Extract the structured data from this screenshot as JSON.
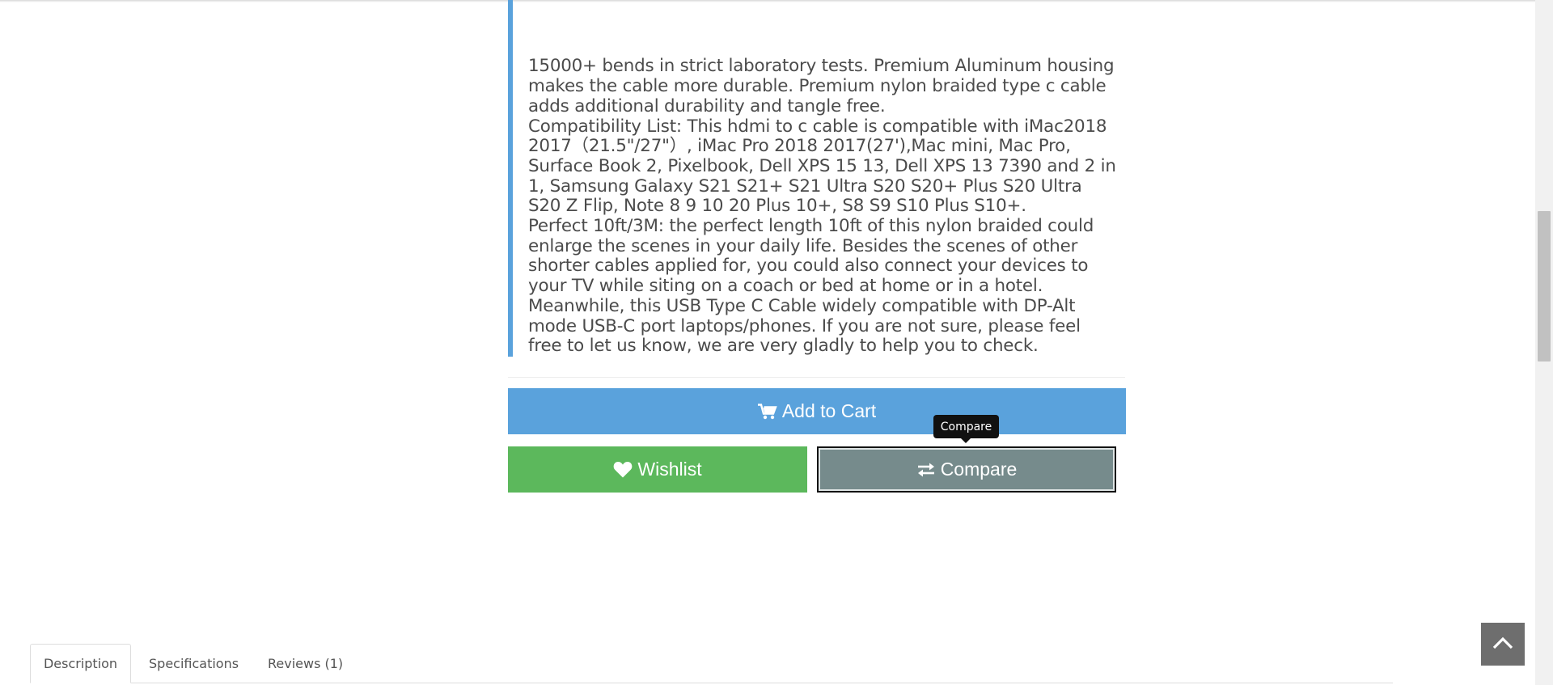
{
  "description": {
    "paragraphs": [
      "15000+ bends in strict laboratory tests. Premium Aluminum housing makes the cable more durable. Premium nylon braided type c cable adds additional durability and tangle free.",
      "Compatibility List: This hdmi to c cable is compatible with iMac2018 2017（21.5\"/27\"）, iMac Pro 2018 2017(27'),Mac mini, Mac Pro, Surface Book 2, Pixelbook, Dell XPS 15 13, Dell XPS 13 7390 and 2 in 1, Samsung Galaxy S21 S21+ S21 Ultra S20 S20+ Plus S20 Ultra S20 Z Flip, Note 8 9 10 20 Plus 10+, S8 S9 S10 Plus S10+.",
      "Perfect 10ft/3M: the perfect length 10ft of this nylon braided could enlarge the scenes in your daily life. Besides the scenes of other shorter cables applied for, you could also connect your devices to your TV while siting on a coach or bed at home or in a hotel. Meanwhile, this USB Type C Cable widely compatible with DP-Alt mode USB-C port laptops/phones. If you are not sure, please feel free to let us know, we are very gladly to help you to check."
    ]
  },
  "actions": {
    "add_to_cart": "Add to Cart",
    "wishlist": "Wishlist",
    "compare": "Compare",
    "compare_tooltip": "Compare"
  },
  "tabs": [
    {
      "label": "Description",
      "active": true
    },
    {
      "label": "Specifications",
      "active": false
    },
    {
      "label": "Reviews (1)",
      "active": false
    }
  ],
  "colors": {
    "cart_button": "#5aa2dc",
    "wishlist_button": "#5cb85c",
    "compare_button": "#768b8c",
    "quote_border": "#5aa2dc"
  },
  "icons": {
    "cart": "shopping-cart-icon",
    "wishlist": "heart-icon",
    "compare": "exchange-arrows-icon",
    "back_to_top": "chevron-up-icon"
  }
}
